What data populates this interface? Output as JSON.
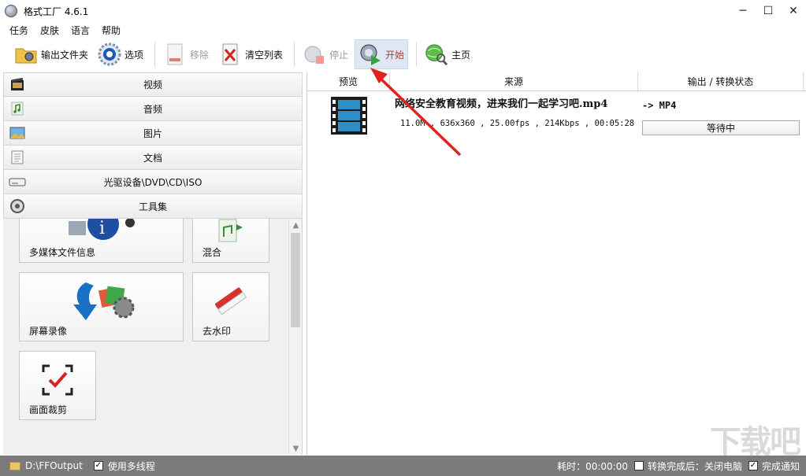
{
  "window": {
    "title": "格式工厂 4.6.1",
    "controls": {
      "minimize": "─",
      "maximize": "☐",
      "close": "✕"
    }
  },
  "menu": [
    "任务",
    "皮肤",
    "语言",
    "帮助"
  ],
  "toolbar": {
    "output_folder": "输出文件夹",
    "options": "选项",
    "remove": "移除",
    "clear_list": "清空列表",
    "stop": "停止",
    "start": "开始",
    "home": "主页"
  },
  "categories": [
    {
      "label": "视频",
      "icon": "film-icon"
    },
    {
      "label": "音频",
      "icon": "music-icon"
    },
    {
      "label": "图片",
      "icon": "picture-icon"
    },
    {
      "label": "文档",
      "icon": "document-icon"
    },
    {
      "label": "光驱设备\\DVD\\CD\\ISO",
      "icon": "disc-drive-icon"
    },
    {
      "label": "工具集",
      "icon": "toolbox-icon"
    }
  ],
  "tools": [
    {
      "label": "多媒体文件信息",
      "icon": "media-info-icon"
    },
    {
      "label": "混合",
      "icon": "mix-icon"
    },
    {
      "label": "屏幕录像",
      "icon": "screen-record-icon"
    },
    {
      "label": "去水印",
      "icon": "eraser-icon"
    },
    {
      "label": "画面裁剪",
      "icon": "crop-icon"
    }
  ],
  "table": {
    "headers": {
      "preview": "预览",
      "source": "来源",
      "output": "输出 / 转换状态"
    },
    "rows": [
      {
        "file_name": "网络安全教育视频，进来我们一起学习吧.mp4",
        "meta": "11.0M , 636x360 , 25.00fps , 214Kbps , 00:05:28",
        "output_format": "-> MP4",
        "status": "等待中"
      }
    ]
  },
  "statusbar": {
    "output_path": "D:\\FFOutput",
    "multithread_label": "使用多线程",
    "elapsed": "耗时：00:00:00",
    "after_convert": "转换完成后：关闭电脑",
    "notify_label": "完成通知"
  },
  "watermark": "下载吧",
  "colors": {
    "accent_red": "#e0231e",
    "statusbar_bg": "#7b7b7b",
    "active_btn_bg": "#dde8f4"
  }
}
